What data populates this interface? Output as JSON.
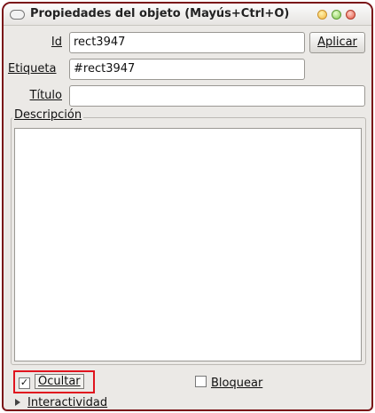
{
  "window": {
    "title": "Propiedades del objeto (Mayús+Ctrl+O)"
  },
  "fields": {
    "id_label": "Id",
    "id_value": "rect3947",
    "apply_label": "Aplicar",
    "label_label": "Etiqueta",
    "label_value": "#rect3947",
    "title_label": "Título",
    "title_value": ""
  },
  "description": {
    "label": "Descripción",
    "value": ""
  },
  "checks": {
    "hide_label": "Ocultar",
    "hide_checked": true,
    "hide_mark": "✓",
    "lock_label": "Bloquear",
    "lock_checked": false
  },
  "interactivity": {
    "label": "Interactividad",
    "expanded": false
  },
  "colors": {
    "window_border": "#7a1418",
    "highlight": "#e0141e"
  }
}
